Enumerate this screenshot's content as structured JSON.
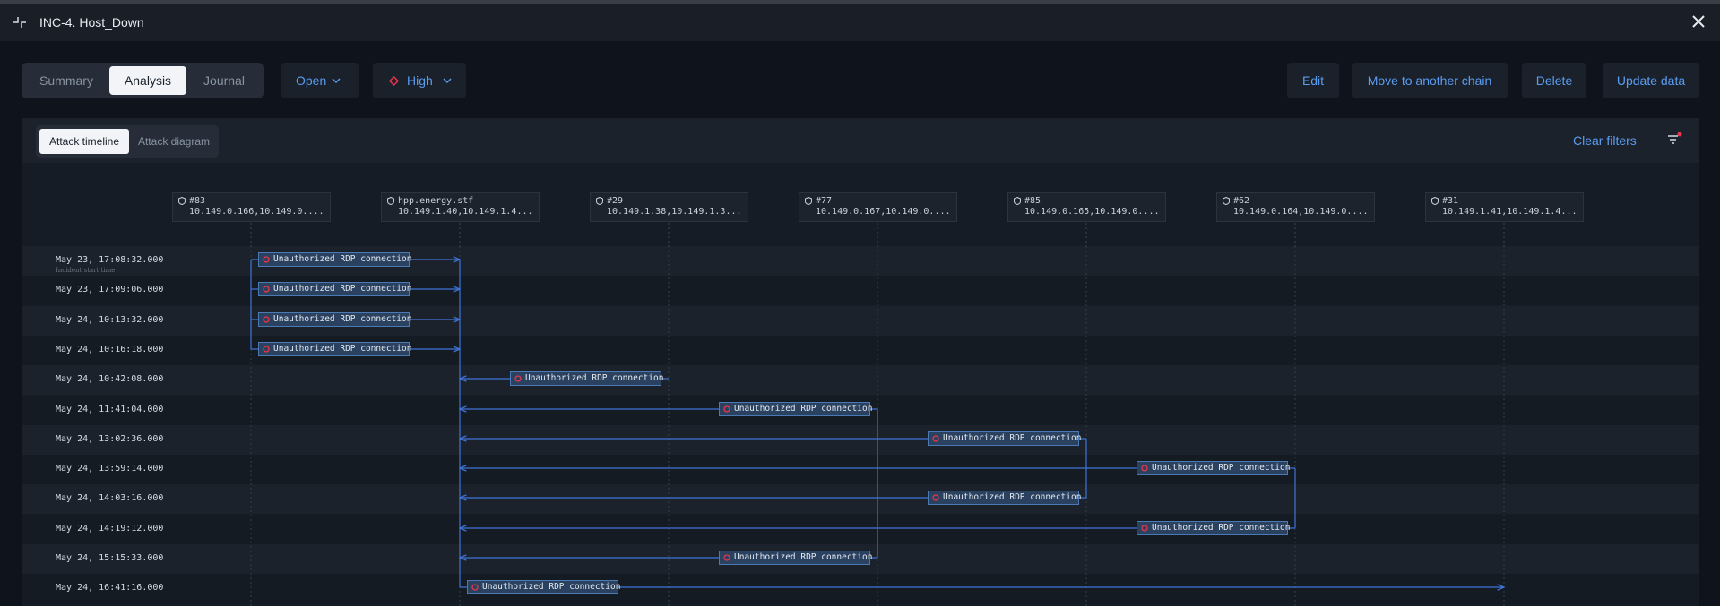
{
  "window": {
    "title": "INC-4. Host_Down"
  },
  "tabs": [
    {
      "label": "Summary"
    },
    {
      "label": "Analysis"
    },
    {
      "label": "Journal"
    }
  ],
  "status": {
    "value": "Open"
  },
  "severity": {
    "value": "High",
    "color": "#e8364b"
  },
  "actions": {
    "edit": "Edit",
    "move": "Move to another chain",
    "delete": "Delete",
    "update": "Update data"
  },
  "view_tabs": [
    {
      "label": "Attack timeline"
    },
    {
      "label": "Attack diagram"
    }
  ],
  "clear_filters": "Clear filters",
  "filter_active_dot_color": "#e8364b",
  "hosts": [
    {
      "name": "#83",
      "ips": "10.149.0.166,10.149.0...."
    },
    {
      "name": "hpp.energy.stf",
      "ips": "10.149.1.40,10.149.1.4..."
    },
    {
      "name": "#29",
      "ips": "10.149.1.38,10.149.1.3..."
    },
    {
      "name": "#77",
      "ips": "10.149.0.167,10.149.0...."
    },
    {
      "name": "#85",
      "ips": "10.149.0.165,10.149.0...."
    },
    {
      "name": "#62",
      "ips": "10.149.0.164,10.149.0...."
    },
    {
      "name": "#31",
      "ips": "10.149.1.41,10.149.1.4..."
    }
  ],
  "rows": [
    {
      "time": "May 23, 17:08:32.000",
      "sub": "Incident start time"
    },
    {
      "time": "May 23, 17:09:06.000"
    },
    {
      "time": "May 24, 10:13:32.000"
    },
    {
      "time": "May 24, 10:16:18.000"
    },
    {
      "time": "May 24, 10:42:08.000"
    },
    {
      "time": "May 24, 11:41:04.000"
    },
    {
      "time": "May 24, 13:02:36.000"
    },
    {
      "time": "May 24, 13:59:14.000"
    },
    {
      "time": "May 24, 14:03:16.000"
    },
    {
      "time": "May 24, 14:19:12.000"
    },
    {
      "time": "May 24, 15:15:33.000"
    },
    {
      "time": "May 24, 16:41:16.000"
    }
  ],
  "events": [
    {
      "label": "Unauthorized RDP connection",
      "row": 0,
      "from": 0,
      "to": 1
    },
    {
      "label": "Unauthorized RDP connection",
      "row": 1,
      "from": 0,
      "to": 1
    },
    {
      "label": "Unauthorized RDP connection",
      "row": 2,
      "from": 0,
      "to": 1
    },
    {
      "label": "Unauthorized RDP connection",
      "row": 3,
      "from": 0,
      "to": 1
    },
    {
      "label": "Unauthorized RDP connection",
      "row": 4,
      "from": 2,
      "to": 1
    },
    {
      "label": "Unauthorized RDP connection",
      "row": 5,
      "from": 3,
      "to": 1
    },
    {
      "label": "Unauthorized RDP connection",
      "row": 6,
      "from": 4,
      "to": 1
    },
    {
      "label": "Unauthorized RDP connection",
      "row": 7,
      "from": 5,
      "to": 1
    },
    {
      "label": "Unauthorized RDP connection",
      "row": 8,
      "from": 4,
      "to": 1
    },
    {
      "label": "Unauthorized RDP connection",
      "row": 9,
      "from": 5,
      "to": 1
    },
    {
      "label": "Unauthorized RDP connection",
      "row": 10,
      "from": 3,
      "to": 1
    },
    {
      "label": "Unauthorized RDP connection",
      "row": 11,
      "from": 1,
      "to": 6
    }
  ],
  "colors": {
    "accent": "#5b9cf0",
    "line": "#3f74d6",
    "event_bg": "#2a4160",
    "event_border": "#4a79b3",
    "alert": "#e8364b"
  }
}
